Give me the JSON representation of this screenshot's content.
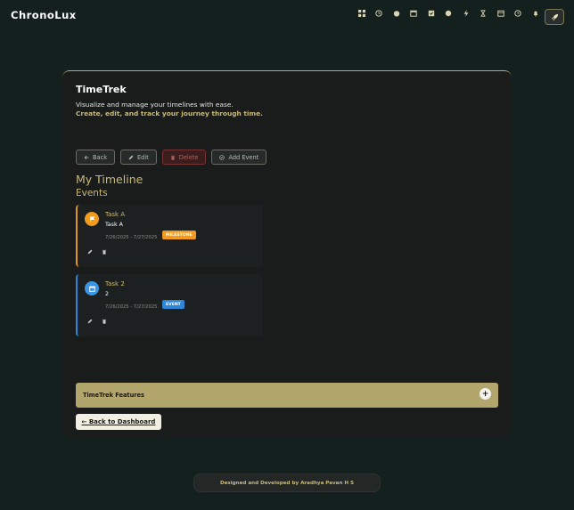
{
  "brand": "ChronoLux",
  "nav_icons": [
    "grid-icon",
    "clock-icon",
    "stopwatch-icon",
    "calendar-plus-icon",
    "check-calendar-icon",
    "globe-icon",
    "bolt-icon",
    "hourglass-icon",
    "calendar-icon",
    "alarm-icon",
    "bell-icon"
  ],
  "card": {
    "title": "TimeTrek",
    "subtitle": "Visualize and manage your timelines with ease.",
    "tagline": "Create, edit, and track your journey through time."
  },
  "toolbar": {
    "back": "Back",
    "edit": "Edit",
    "delete": "Delete",
    "add_event": "Add Event"
  },
  "timeline": {
    "title": "My Timeline",
    "events_heading": "Events",
    "events": [
      {
        "name": "Task A",
        "description": "Task A",
        "dates": "7/26/2025 - 7/27/2025",
        "badge": "MILESTONE"
      },
      {
        "name": "Task 2",
        "description": "2",
        "dates": "7/26/2025 - 7/27/2025",
        "badge": "EVENT"
      }
    ]
  },
  "features": {
    "label": "TimeTrek Features",
    "toggle": "+"
  },
  "back_dashboard": "← Back to Dashboard",
  "footer": "Designed and Developed by Aradhya Pavan H S",
  "colors": {
    "accent": "#c9b977",
    "milestone": "#f09a1f",
    "event": "#2f86d8"
  }
}
